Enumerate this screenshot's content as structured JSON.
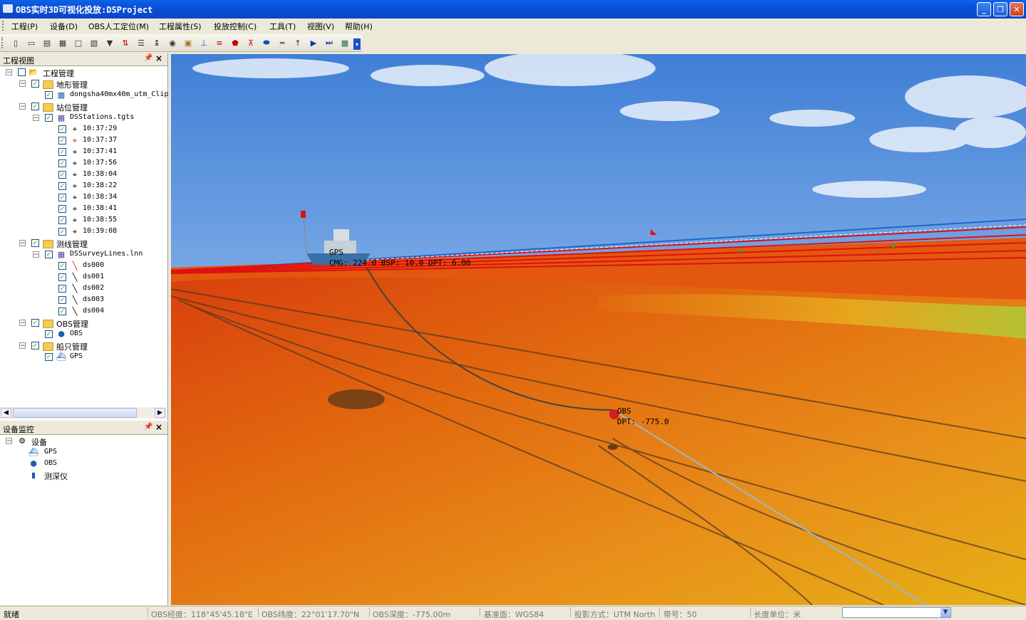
{
  "window": {
    "title": "OBS实时3D可视化投放:DSProject"
  },
  "menu": [
    "工程(P)",
    "设备(D)",
    "OBS人工定位(M)",
    "工程属性(S)",
    "投放控制(C)",
    "工具(T)",
    "视图(V)",
    "帮助(H)"
  ],
  "project_panel": {
    "title": "工程视图",
    "root": "工程管理",
    "terrain": {
      "label": "地形管理",
      "item": "dongsha40mx40m_utm_Clip"
    },
    "stations": {
      "label": "站位管理",
      "file": "DSStations.tgts",
      "items": [
        "10:37:29",
        "10:37:37",
        "10:37:41",
        "10:37:56",
        "10:38:04",
        "10:38:22",
        "10:38:34",
        "10:38:41",
        "10:38:55",
        "10:39:08"
      ]
    },
    "lines": {
      "label": "测线管理",
      "file": "DSSurveyLines.lnn",
      "items": [
        "ds000",
        "ds001",
        "ds002",
        "ds003",
        "ds004"
      ]
    },
    "obs": {
      "label": "OBS管理",
      "item": "OBS"
    },
    "ship": {
      "label": "船只管理",
      "item": "GPS"
    }
  },
  "device_panel": {
    "title": "设备监控",
    "root": "设备",
    "items": [
      "GPS",
      "OBS",
      "测深仪"
    ]
  },
  "scene": {
    "ship_label": "GPS",
    "ship_readout": "CMG: 224.0   BSP: 10.0   DPT: 6.00",
    "obs_label": "OBS",
    "obs_depth": "DPT: -775.0"
  },
  "status": {
    "ready": "就绪",
    "lon": "OBS经度：118°45'45.18\"E",
    "lat": "OBS纬度：22°01'17.70\"N",
    "depth": "OBS深度：-775.00m",
    "datum": "基准面：WGS84",
    "projection": "投影方式：UTM North",
    "zone": "带号：50",
    "unit": "长度单位：米"
  },
  "colors": {
    "title_bar": "#0a4fd6",
    "sky": "#6aa0e0",
    "terrain": "#e87b10",
    "survey_line": "#e01010"
  }
}
